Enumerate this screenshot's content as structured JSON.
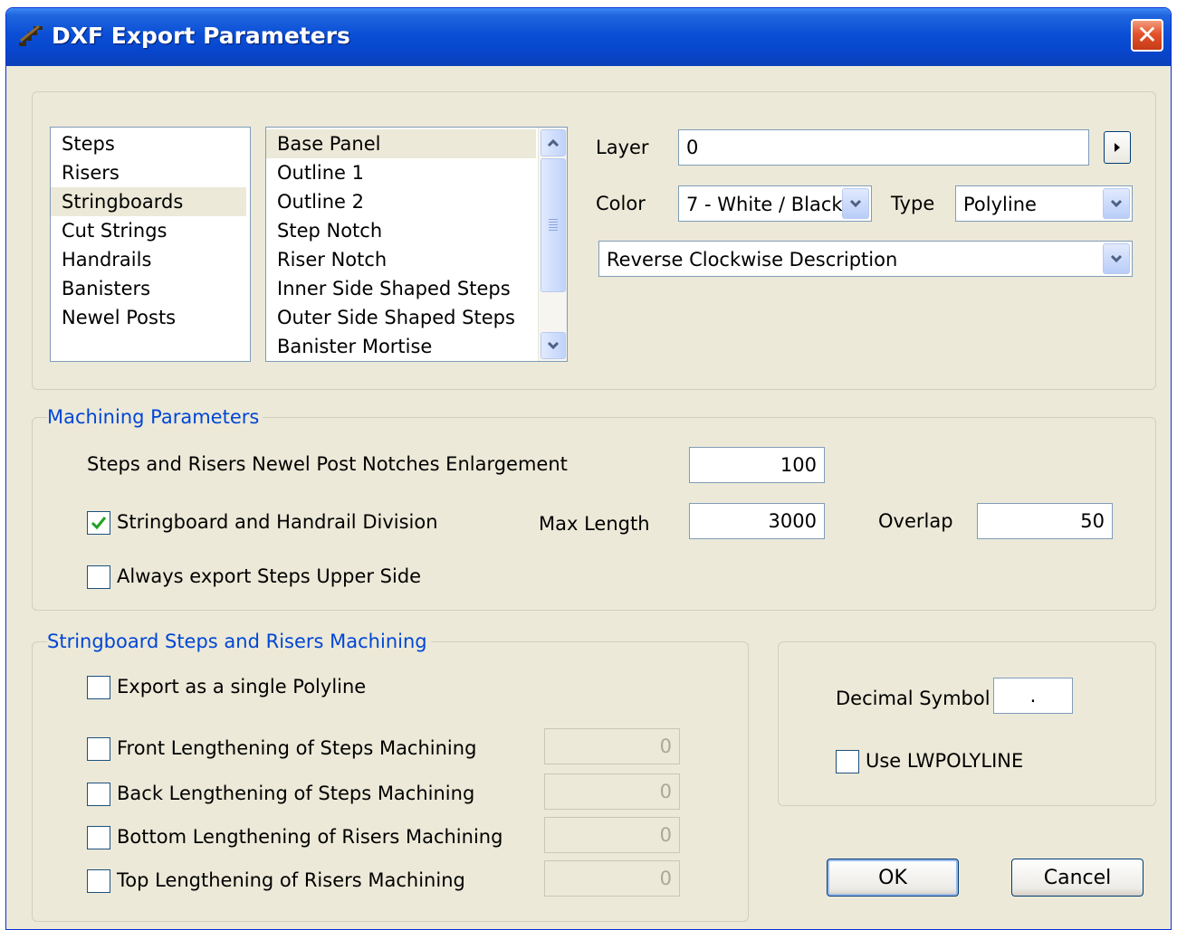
{
  "window": {
    "title": "DXF Export Parameters",
    "close_symbol": "✕"
  },
  "categories": {
    "items": [
      "Steps",
      "Risers",
      "Stringboards",
      "Cut Strings",
      "Handrails",
      "Banisters",
      "Newel Posts"
    ],
    "selected": "Stringboards"
  },
  "elements": {
    "items": [
      "Base Panel",
      "Outline 1",
      "Outline 2",
      "Step Notch",
      "Riser Notch",
      "Inner Side Shaped Steps",
      "Outer Side Shaped Steps",
      "Banister Mortise"
    ],
    "selected": "Base Panel"
  },
  "props": {
    "layer_label": "Layer",
    "layer_value": "0",
    "color_label": "Color",
    "color_value": "7 - White / Black",
    "type_label": "Type",
    "type_value": "Polyline",
    "direction_value": "Reverse Clockwise Description"
  },
  "machining": {
    "legend": "Machining Parameters",
    "enlargement_label": "Steps and Risers Newel Post Notches Enlargement",
    "enlargement_value": "100",
    "division_label": "Stringboard and Handrail Division",
    "division_checked": true,
    "max_length_label": "Max Length",
    "max_length_value": "3000",
    "overlap_label": "Overlap",
    "overlap_value": "50",
    "upper_side_label": "Always export Steps Upper Side",
    "upper_side_checked": false
  },
  "stringboard": {
    "legend": "Stringboard Steps and Risers Machining",
    "single_polyline_label": "Export as a single Polyline",
    "options": [
      {
        "label": "Front Lengthening of Steps Machining",
        "value": "0",
        "checked": false
      },
      {
        "label": "Back Lengthening of Steps Machining",
        "value": "0",
        "checked": false
      },
      {
        "label": "Bottom Lengthening of Risers Machining",
        "value": "0",
        "checked": false
      },
      {
        "label": "Top Lengthening of Risers Machining",
        "value": "0",
        "checked": false
      }
    ]
  },
  "format": {
    "decimal_label": "Decimal Symbol",
    "decimal_value": ".",
    "lwpolyline_label": "Use LWPOLYLINE",
    "lwpolyline_checked": false
  },
  "buttons": {
    "ok": "OK",
    "cancel": "Cancel"
  },
  "icons": {
    "app": "stair-app-icon",
    "close": "close-icon",
    "arrow_right": "arrow-right-icon",
    "chevron_down": "chevron-down-icon",
    "chevron_up": "chevron-up-icon",
    "check": "check-icon"
  },
  "colors": {
    "title_bar": "#0a4fd6",
    "legend": "#0046d5",
    "dialog_bg": "#ece9d8",
    "close_button": "#e3532c"
  }
}
